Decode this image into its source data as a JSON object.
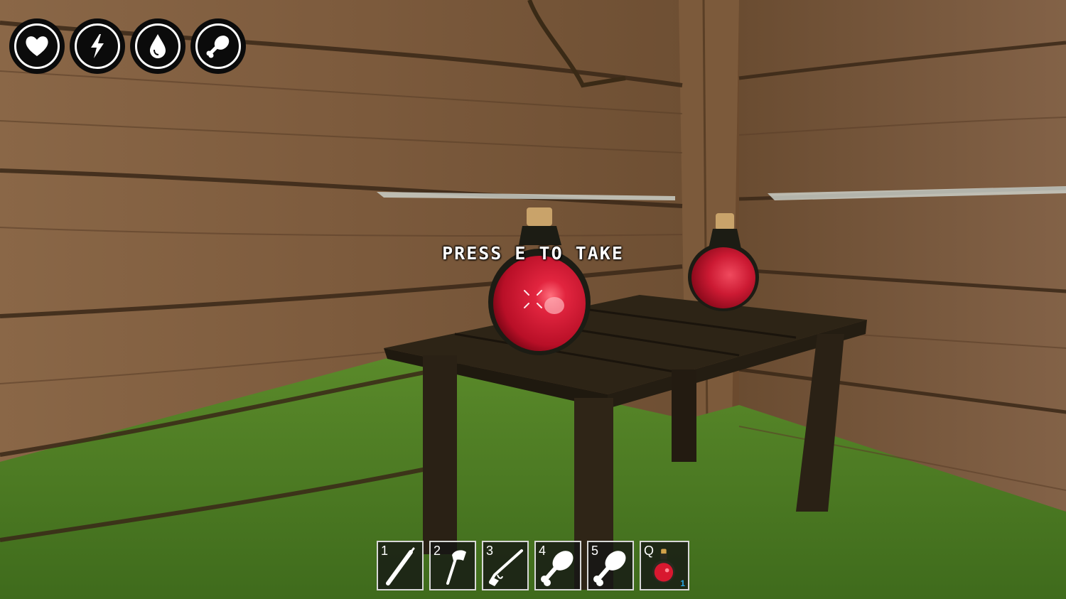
{
  "hud": {
    "stats": [
      {
        "name": "health",
        "icon": "heart-icon"
      },
      {
        "name": "stamina",
        "icon": "lightning-icon"
      },
      {
        "name": "thirst",
        "icon": "water-drop-icon"
      },
      {
        "name": "hunger",
        "icon": "meat-drumstick-icon"
      }
    ]
  },
  "prompt": {
    "before": "PRESS",
    "key": "E",
    "after": "TO TAKE"
  },
  "hotbar": {
    "slots": [
      {
        "key": "1",
        "icon": "stick-icon"
      },
      {
        "key": "2",
        "icon": "axe-icon"
      },
      {
        "key": "3",
        "icon": "shotgun-icon"
      },
      {
        "key": "4",
        "icon": "meat-drumstick-icon"
      },
      {
        "key": "5",
        "icon": "meat-drumstick-icon"
      },
      {
        "key": "Q",
        "icon": "red-potion-icon",
        "count": "1"
      }
    ]
  },
  "colors": {
    "potion": "#c8152d",
    "wood": "#7a5634",
    "grass": "#4f7d23",
    "table": "#2e2617",
    "slot_border": "#d8d8d8",
    "count": "#27a9e8"
  }
}
